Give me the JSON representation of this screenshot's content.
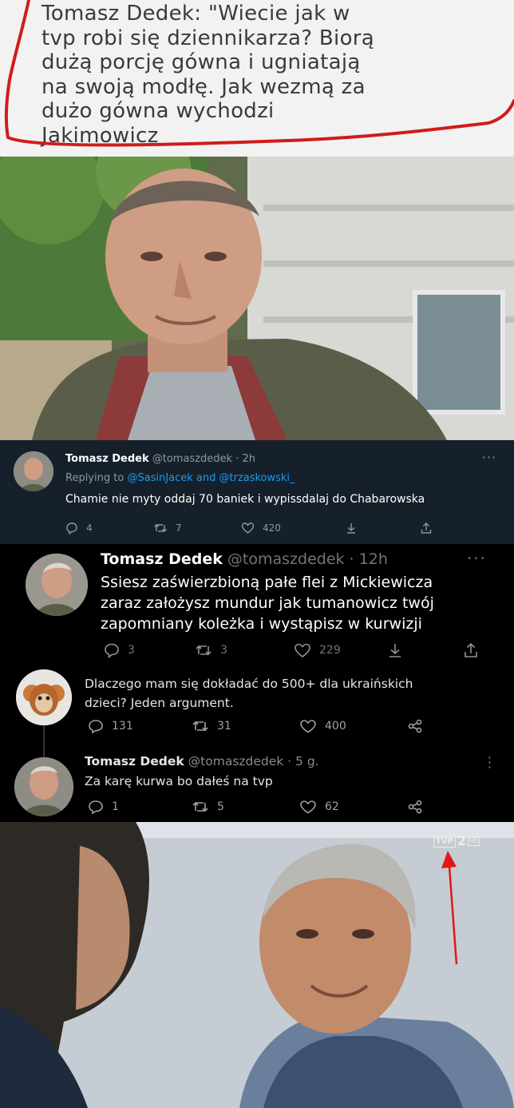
{
  "quote": {
    "lines": [
      "Tomasz Dedek: \"Wiecie jak w",
      "tvp robi się dziennikarza? Biorą",
      "dużą porcję gówna i ugniatają",
      "na swoją modłę. Jak wezmą za",
      "dużo gówna wychodzi",
      "Jakimowicz"
    ]
  },
  "tweet1": {
    "name": "Tomasz Dedek",
    "handle": "@tomaszdedek · 2h",
    "replying_prefix": "Replying to",
    "replying_to": "@SasinJacek and @trzaskowski_",
    "text": "Chamie nie myty oddaj 70 baniek i wypissdalaj do Chabarowska",
    "replies": "4",
    "retweets": "7",
    "likes": "420"
  },
  "tweet2": {
    "name": "Tomasz Dedek",
    "handle": "@tomaszdedek · 12h",
    "lines": [
      "Ssiesz zaświerzbioną pałe flei z Mickiewicza",
      "zaraz założysz mundur jak tumanowicz twój",
      "zapomniany koleżka i wystąpisz w kurwizji"
    ],
    "replies": "3",
    "retweets": "3",
    "likes": "229"
  },
  "thread": {
    "parent_lines": [
      "Dlaczego mam się dokładać do 500+ dla ukraińskich",
      "dzieci? Jeden argument."
    ],
    "parent_replies": "131",
    "parent_retweets": "31",
    "parent_likes": "400",
    "reply_name": "Tomasz Dedek",
    "reply_handle": "@tomaszdedek · 5 g.",
    "reply_text": "Za karę kurwa bo dałeś na tvp",
    "reply_replies": "1",
    "reply_retweets": "5",
    "reply_likes": "62"
  },
  "logo": {
    "tvp": "TVP",
    "channel": "2",
    "hd": "HD"
  },
  "colors": {
    "twitter_dim_bg": "#15202b",
    "twitter_blue": "#1d9bf0",
    "quote_outline": "#d01c1c",
    "arrow": "#e01818"
  },
  "icons": [
    "reply-icon",
    "retweet-icon",
    "like-icon",
    "bookmark-icon",
    "share-icon",
    "more-icon"
  ]
}
